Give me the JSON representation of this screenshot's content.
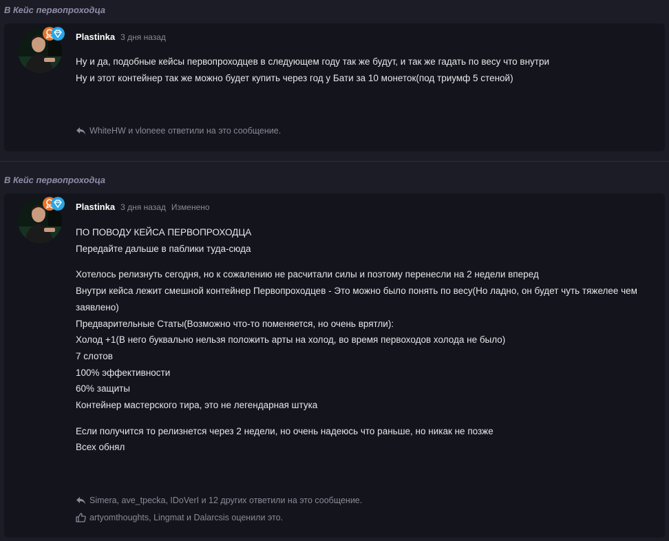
{
  "posts": [
    {
      "thread": "В Кейс первопроходца",
      "username": "Plastinka",
      "time": "3 дня назад",
      "edited": "",
      "body": [
        "Ну и да, подобные кейсы первопроходцев в следующем году так же будут, и так же гадать по весу что внутри",
        "Ну и этот контейнер так же можно будет купить через год у Бати за 10 монеток(под триумф 5 стеной)"
      ],
      "replies": "WhiteHW и vloneee ответили на это сообщение.",
      "likes": ""
    },
    {
      "thread": "В Кейс первопроходца",
      "username": "Plastinka",
      "time": "3 дня назад",
      "edited": "Изменено",
      "body_paragraphs": [
        [
          "ПО ПОВОДУ КЕЙСА ПЕРВОПРОХОДЦА",
          "Передайте дальше в паблики туда-сюда"
        ],
        [
          "Хотелось релизнуть сегодня, но к сожалению не расчитали силы и поэтому перенесли на 2 недели вперед",
          "Внутри кейса лежит смешной контейнер Первопроходцев - Это можно было понять по весу(Но ладно, он будет чуть тяжелее чем заявлено)",
          "Предварительные Статы(Возможно что-то поменяется, но очень врятли):",
          "Холод +1(В него буквально нельзя положить арты на холод, во время первоходов холода не было)",
          "7 слотов",
          "100% эффективности",
          "60% защиты",
          "Контейнер мастерского тира, это не легендарная штука"
        ],
        [
          "Если получится то релизнется через 2 недели, но очень надеюсь что раньше, но никак не позже",
          "Всех обнял"
        ]
      ],
      "replies": "Simera, ave_tpecka, IDoVerI и 12 других ответили на это сообщение.",
      "likes": "artyomthoughts, Lingmat и Dalarcsis оценили это."
    }
  ],
  "icons": {
    "reply": "reply-arrow-icon",
    "like": "thumbs-up-icon",
    "badge_orange": "rank-badge-icon",
    "badge_blue": "diamond-badge-icon"
  },
  "colors": {
    "page_bg": "#1c1c26",
    "card_bg": "#14141c",
    "muted_text": "#8a8a9a",
    "thread_link": "#8e8ea8",
    "badge_orange": "#e8742a",
    "badge_blue": "#2aa6e8"
  }
}
